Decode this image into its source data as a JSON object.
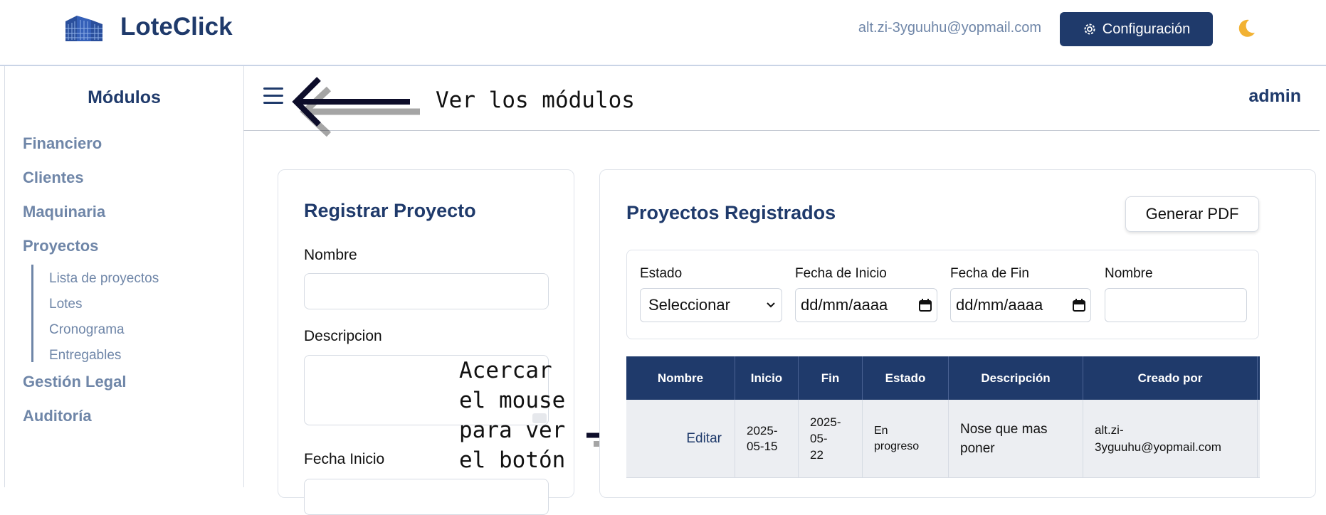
{
  "header": {
    "brand": "LoteClick",
    "email": "alt.zi-3yguuhu@yopmail.com",
    "config_label": "Configuración"
  },
  "sidebar": {
    "title": "Módulos",
    "items": [
      {
        "label": "Financiero"
      },
      {
        "label": "Clientes"
      },
      {
        "label": "Maquinaria"
      },
      {
        "label": "Proyectos"
      },
      {
        "label": "Gestión Legal"
      },
      {
        "label": "Auditoría"
      }
    ],
    "sub_items": [
      {
        "label": "Lista de proyectos"
      },
      {
        "label": "Lotes"
      },
      {
        "label": "Cronograma"
      },
      {
        "label": "Entregables"
      }
    ]
  },
  "main": {
    "user": "admin",
    "annotation_modules": "Ver los módulos",
    "annotation_mouse": "Acercar\nel mouse\npara ver\nel botón"
  },
  "register_form": {
    "title": "Registrar Proyecto",
    "name_label": "Nombre",
    "description_label": "Descripcion",
    "start_label": "Fecha Inicio"
  },
  "projects": {
    "title": "Proyectos Registrados",
    "pdf_label": "Generar PDF",
    "filters": {
      "estado_label": "Estado",
      "estado_value": "Seleccionar",
      "inicio_label": "Fecha de Inicio",
      "inicio_placeholder": "dd/mm/aaaa",
      "fin_label": "Fecha de Fin",
      "fin_placeholder": "dd/mm/aaaa",
      "nombre_label": "Nombre"
    },
    "columns": [
      "Nombre",
      "Inicio",
      "Fin",
      "Estado",
      "Descripción",
      "Creado por"
    ],
    "rows": [
      {
        "action": "Editar",
        "inicio": "2025-\n05-15",
        "fin": "2025-\n05-\n22",
        "estado": "En\nprogreso",
        "descripcion": "Nose que mas\nponer",
        "creado_por": "alt.zi-\n3yguuhu@yopmail.com"
      }
    ]
  }
}
